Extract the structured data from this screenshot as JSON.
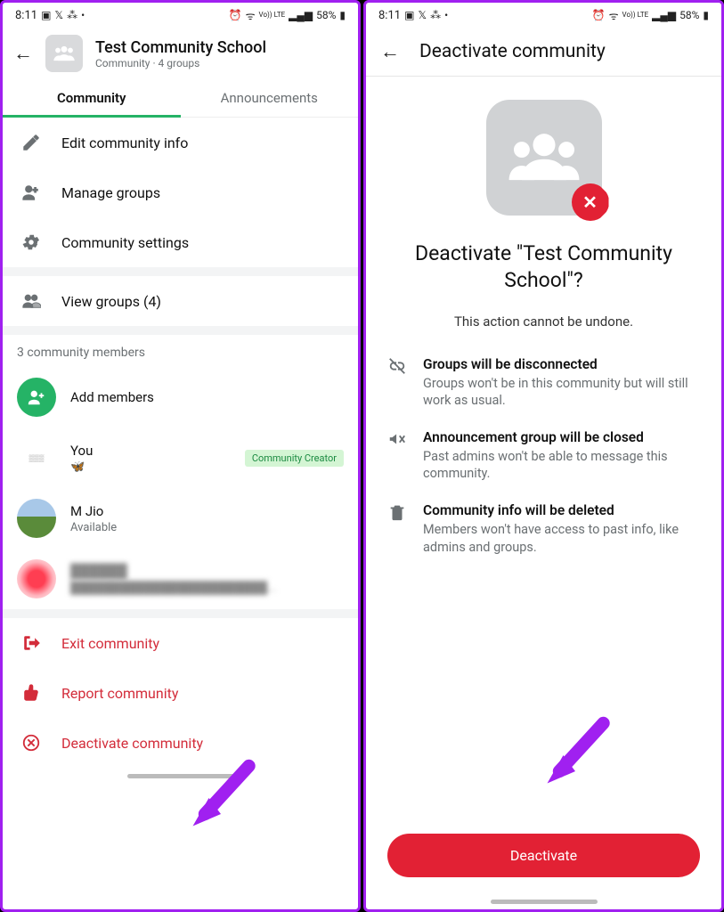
{
  "status": {
    "time": "8:11",
    "battery": "58%",
    "lte": "Vo)) LTE"
  },
  "left": {
    "header": {
      "title": "Test Community School",
      "subtitle": "Community · 4 groups"
    },
    "tabs": {
      "community": "Community",
      "announcements": "Announcements"
    },
    "rows": {
      "edit": "Edit community info",
      "manage": "Manage groups",
      "settings": "Community settings",
      "view_groups": "View groups (4)"
    },
    "members_label": "3 community members",
    "add_members": "Add members",
    "members": [
      {
        "name": "You",
        "status": "🦋",
        "badge": "Community Creator"
      },
      {
        "name": "M Jio",
        "status": "Available",
        "badge": null
      },
      {
        "name": "██████",
        "status": "████████████████████████...",
        "badge": null
      }
    ],
    "actions": {
      "exit": "Exit community",
      "report": "Report community",
      "deactivate": "Deactivate community"
    }
  },
  "right": {
    "title": "Deactivate community",
    "confirm_title": "Deactivate \"Test Community School\"?",
    "confirm_sub": "This action cannot be undone.",
    "bullets": [
      {
        "head": "Groups will be disconnected",
        "body": "Groups won't be in this community but will still work as usual."
      },
      {
        "head": "Announcement group will be closed",
        "body": "Past admins won't be able to message this community."
      },
      {
        "head": "Community info will be deleted",
        "body": "Members won't have access to past info, like admins and groups."
      }
    ],
    "button": "Deactivate"
  }
}
